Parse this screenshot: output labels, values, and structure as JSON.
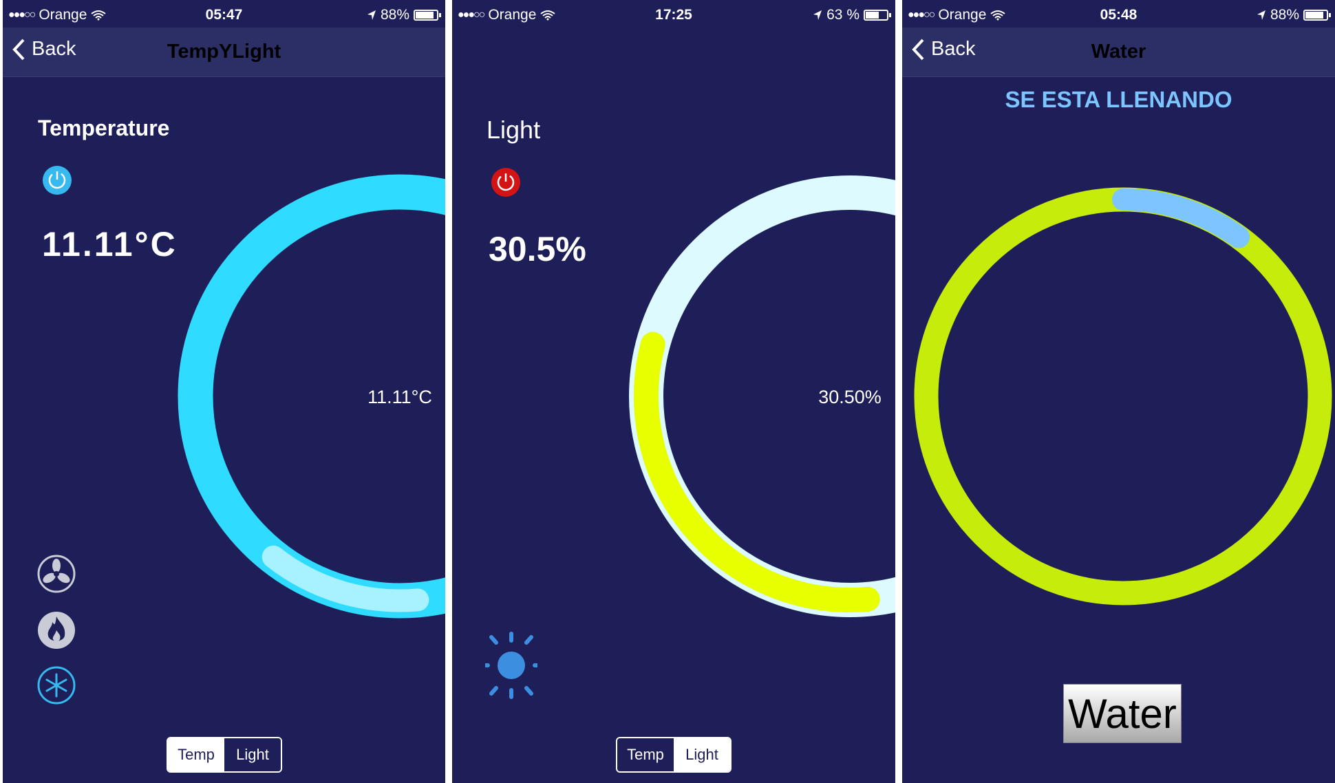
{
  "screens": [
    {
      "status": {
        "carrier": "Orange",
        "time": "05:47",
        "battery": "88%",
        "battery_level": 0.88
      },
      "nav": {
        "back": "Back",
        "title": "TempYLight"
      },
      "heading": "Temperature",
      "value": "11.11°C",
      "gauge": {
        "label": "11.11°C",
        "fraction": 0.12,
        "track_color": "#2fdcff",
        "progress_color": "#a8f2ff"
      },
      "segmented": {
        "left": "Temp",
        "right": "Light"
      },
      "icons": [
        "fan-icon",
        "fire-icon",
        "snowflake-icon"
      ]
    },
    {
      "status": {
        "carrier": "Orange",
        "time": "17:25",
        "battery": "63 %",
        "battery_level": 0.63
      },
      "heading": "Light",
      "value": "30.5%",
      "gauge": {
        "label": "30.50%",
        "fraction": 0.305,
        "track_color": "#dcfaff",
        "progress_color": "#e8ff00"
      },
      "segmented": {
        "left": "Temp",
        "right": "Light"
      },
      "icons": [
        "sun-icon"
      ]
    },
    {
      "status": {
        "carrier": "Orange",
        "time": "05:48",
        "battery": "88%",
        "battery_level": 0.88
      },
      "nav": {
        "back": "Back",
        "title": "Water"
      },
      "status_text": "SE ESTA LLENANDO",
      "gauge": {
        "fraction": 0.1,
        "track_color": "#c6ec0c",
        "progress_color": "#7dc5ff"
      },
      "button": "Water"
    }
  ]
}
